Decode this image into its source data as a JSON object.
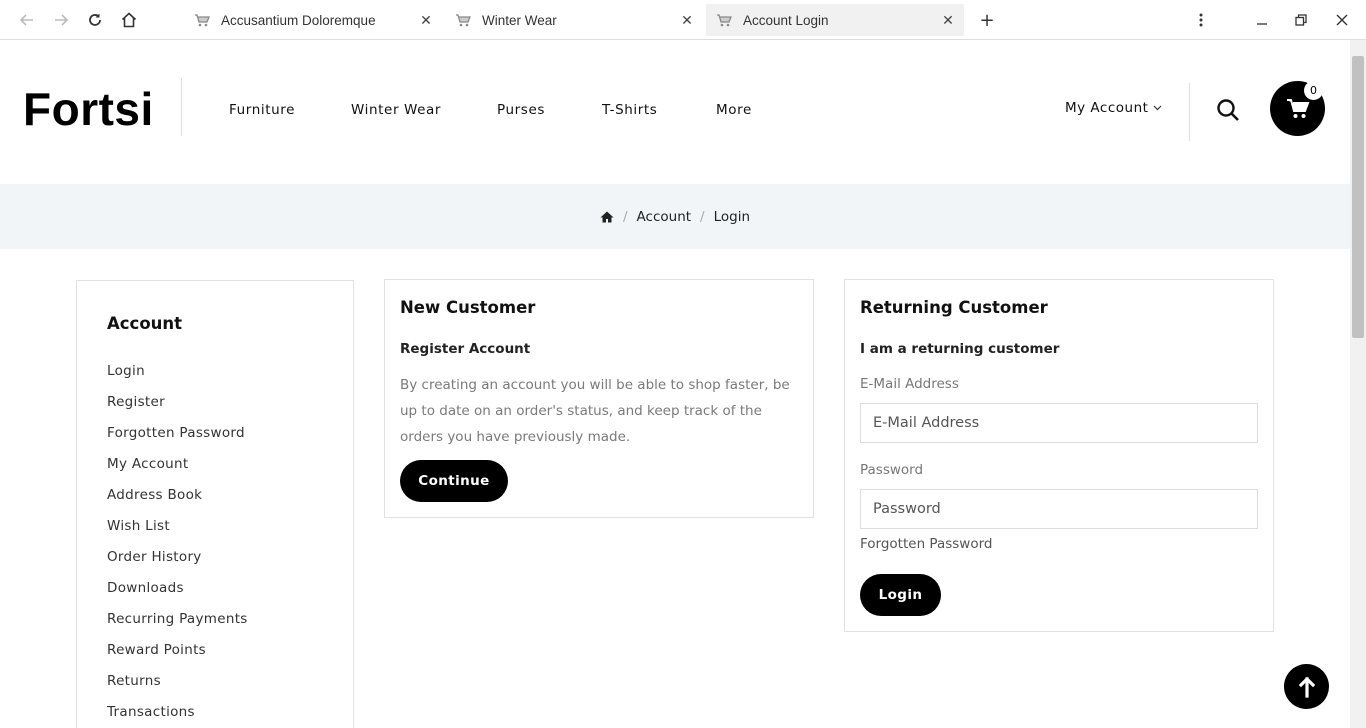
{
  "browser": {
    "tabs": [
      {
        "title": "Accusantium Doloremque",
        "active": false
      },
      {
        "title": "Winter Wear",
        "active": false
      },
      {
        "title": "Account Login",
        "active": true
      }
    ],
    "new_tab_label": "+"
  },
  "header": {
    "logo": "Fortsi",
    "menu": [
      "Furniture",
      "Winter Wear",
      "Purses",
      "T-Shirts",
      "More"
    ],
    "my_account": "My Account",
    "cart_count": "0"
  },
  "breadcrumb": {
    "home_icon": "home-icon",
    "items": [
      "Account",
      "Login"
    ],
    "separator": "/"
  },
  "sidebar": {
    "title": "Account",
    "links": [
      "Login",
      "Register",
      "Forgotten Password",
      "My Account",
      "Address Book",
      "Wish List",
      "Order History",
      "Downloads",
      "Recurring Payments",
      "Reward Points",
      "Returns",
      "Transactions"
    ]
  },
  "new_customer": {
    "title": "New Customer",
    "subtitle": "Register Account",
    "description": "By creating an account you will be able to shop faster, be up to date on an order's status, and keep track of the orders you have previously made.",
    "button": "Continue"
  },
  "returning_customer": {
    "title": "Returning Customer",
    "subtitle": "I am a returning customer",
    "email_label": "E-Mail Address",
    "email_placeholder": "E-Mail Address",
    "email_value": "",
    "password_label": "Password",
    "password_placeholder": "Password",
    "password_value": "",
    "forgotten": "Forgotten Password",
    "button": "Login"
  },
  "colors": {
    "accent": "#000000",
    "breadcrumb_bg": "#f1f5f8",
    "border": "#e2e2e2"
  }
}
